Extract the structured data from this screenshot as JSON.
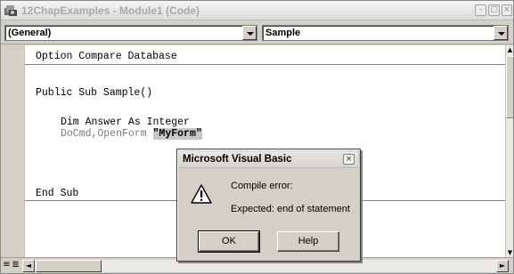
{
  "window": {
    "title": "12ChapExamples - Module1 (Code)",
    "icon": "vba-module-icon",
    "controls": {
      "minimize": "–",
      "maximize": "□",
      "close": "×"
    }
  },
  "selectors": {
    "object": {
      "value": "(General)"
    },
    "procedure": {
      "value": "Sample"
    }
  },
  "code": {
    "lines": [
      {
        "text": "Option Compare Database"
      },
      {
        "text": "Public Sub Sample()"
      },
      {
        "text": "Dim Answer As Integer"
      },
      {
        "prefix": "DoCmd,OpenForm ",
        "highlight": "\"MyForm\""
      },
      {
        "text": "End Sub"
      }
    ]
  },
  "scroll": {
    "up": "▲",
    "down": "▼",
    "left": "◄",
    "right": "►"
  },
  "bottom": {
    "procedure_view": "≡",
    "full_module_view": "≣"
  },
  "dialog": {
    "title": "Microsoft Visual Basic",
    "close": "×",
    "icon": "warning-icon",
    "error_heading": "Compile error:",
    "error_message": "Expected: end of statement",
    "buttons": {
      "ok": "OK",
      "help": "Help"
    }
  },
  "colors": {
    "chrome": "#d4d0c8",
    "inactive_code": "#7a7a7a",
    "highlight": "#c8c8c8",
    "title_text": "#a8a8a8"
  }
}
